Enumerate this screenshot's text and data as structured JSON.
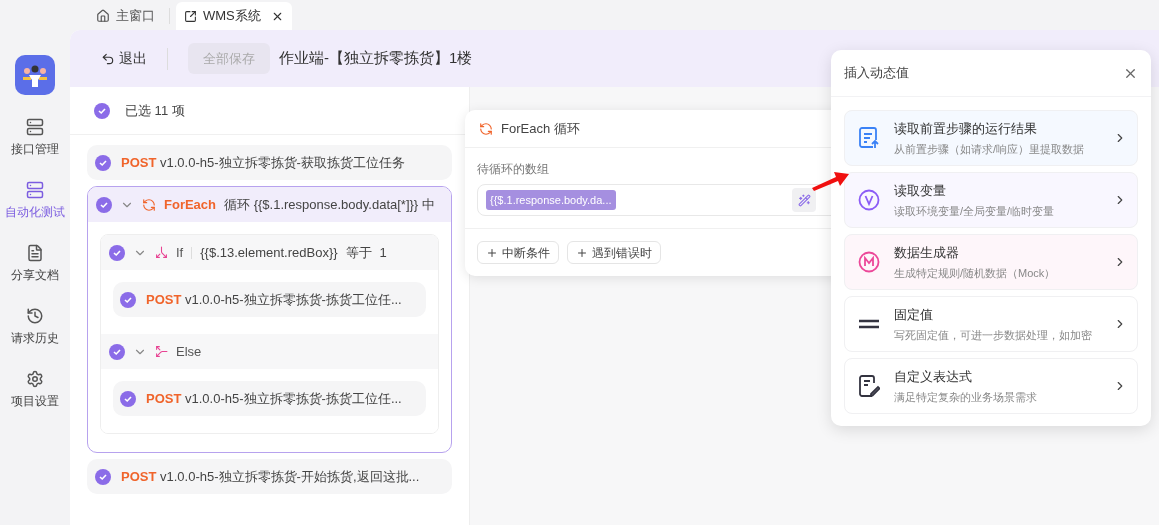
{
  "tabs": [
    {
      "label": "主窗口",
      "kind": "home",
      "selected": false,
      "closable": false
    },
    {
      "label": "WMS系统",
      "kind": "external",
      "selected": true,
      "closable": true
    }
  ],
  "sidebar": {
    "items": [
      {
        "label": "接口管理",
        "kind": "api",
        "selected": false
      },
      {
        "label": "自动化测试",
        "kind": "auto",
        "selected": true
      },
      {
        "label": "分享文档",
        "kind": "share",
        "selected": false
      },
      {
        "label": "请求历史",
        "kind": "history",
        "selected": false
      },
      {
        "label": "项目设置",
        "kind": "settings",
        "selected": false
      }
    ]
  },
  "header": {
    "exit": "退出",
    "save": {
      "label": "全部保存",
      "disabled": true
    },
    "title": "作业端-【独立拆零拣货】1楼"
  },
  "selection": {
    "label": "已选 11 项",
    "checked": true
  },
  "steps": [
    {
      "kind": "request",
      "checked": true,
      "method": "POST",
      "name": "v1.0.0-h5-独立拆零拣货-获取拣货工位任务"
    },
    {
      "kind": "foreach",
      "checked": true,
      "expanded": true,
      "keyword": "ForEach",
      "text": "循环 {{$.1.response.body.data[*]}} 中",
      "children": [
        {
          "kind": "if",
          "checked": true,
          "expanded": true,
          "keyword": "If",
          "condition": "{{$.13.element.redBox}}",
          "operator": "等于",
          "value": "1",
          "children": [
            {
              "kind": "request",
              "checked": true,
              "method": "POST",
              "name": "v1.0.0-h5-独立拆零拣货-拣货工位任..."
            }
          ]
        },
        {
          "kind": "else",
          "checked": true,
          "expanded": true,
          "keyword": "Else",
          "children": [
            {
              "kind": "request",
              "checked": true,
              "method": "POST",
              "name": "v1.0.0-h5-独立拆零拣货-拣货工位任..."
            }
          ]
        }
      ]
    },
    {
      "kind": "request",
      "checked": true,
      "method": "POST",
      "name": "v1.0.0-h5-独立拆零拣货-开始拣货,返回这批..."
    }
  ],
  "foreach_card": {
    "title": "ForEach 循环",
    "field_label": "待循环的数组",
    "tag": "{{$.1.response.body.da...",
    "buttons": [
      "中断条件",
      "遇到错误时"
    ]
  },
  "popover": {
    "title": "插入动态值",
    "options": [
      {
        "kind": "doc",
        "color": "#3b82f6",
        "title": "读取前置步骤的运行结果",
        "description": "从前置步骤（如请求/响应）里提取数据"
      },
      {
        "kind": "v",
        "color": "#8b5cf6",
        "title": "读取变量",
        "description": "读取环境变量/全局变量/临时变量"
      },
      {
        "kind": "m",
        "color": "#ec4899",
        "title": "数据生成器",
        "description": "生成特定规则/随机数据（Mock）"
      },
      {
        "kind": "equals",
        "color": "#ffffff",
        "title": "固定值",
        "description": "写死固定值，可进一步数据处理，如加密"
      },
      {
        "kind": "edit",
        "color": "#ffffff",
        "title": "自定义表达式",
        "description": "满足特定复杂的业务场景需求"
      }
    ]
  }
}
